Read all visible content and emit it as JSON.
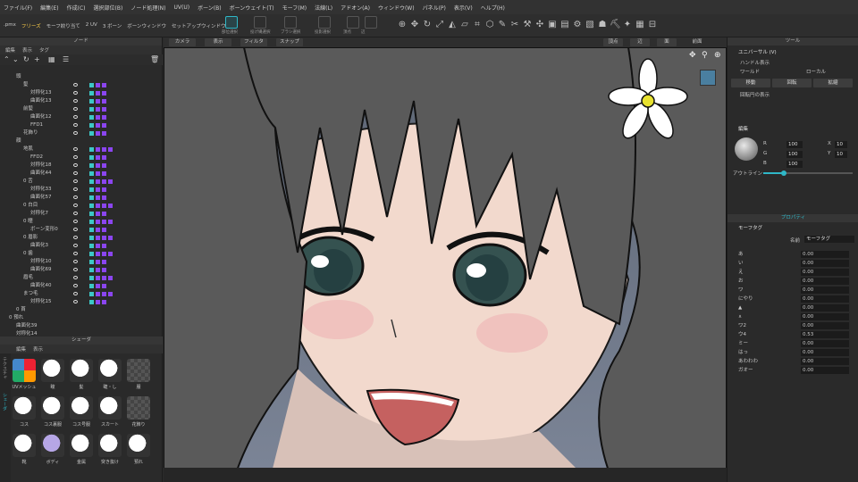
{
  "menu": [
    "ファイル(F)",
    "編集(E)",
    "作成(C)",
    "選択部位(B)",
    "ノード処理(N)",
    "UV(U)",
    "ボーン(B)",
    "ボーンウェイト(T)",
    "モーフ(M)",
    "法線(L)",
    "アドオン(A)",
    "ウィンドウ(W)",
    "パネル(P)",
    "表示(V)",
    "ヘルプ(H)"
  ],
  "toolbar": {
    "left_items": [
      ".pmx",
      "フリーズ",
      "モーフ絞り当て",
      "2 UV",
      "3 ボーン",
      "ボーンウィンドウ",
      "セットアップウィンドウ"
    ],
    "tools": [
      "部位選択",
      "投げ縄選択",
      "ブラシ選択",
      "投影選択",
      "頂点",
      "辺"
    ]
  },
  "left_panel": {
    "title": "ノード",
    "menu": [
      "編集",
      "表示",
      "タグ"
    ],
    "tree": [
      {
        "label": "頭",
        "indent": 1,
        "colors": []
      },
      {
        "label": "髪",
        "indent": 2,
        "colors": [
          "#3cc7c7",
          "#8b45f0",
          "#8b45f0"
        ]
      },
      {
        "label": "対称化13",
        "indent": 3,
        "colors": [
          "#3cc7c7",
          "#8b45f0",
          "#8b45f0"
        ]
      },
      {
        "label": "曲面化13",
        "indent": 3,
        "colors": [
          "#3cc7c7",
          "#8b45f0",
          "#8b45f0"
        ]
      },
      {
        "label": "前髪",
        "indent": 2,
        "colors": [
          "#3cc7c7",
          "#8b45f0",
          "#8b45f0"
        ]
      },
      {
        "label": "曲面化12",
        "indent": 3,
        "colors": [
          "#3cc7c7",
          "#8b45f0",
          "#8b45f0"
        ]
      },
      {
        "label": "FFD1",
        "indent": 3,
        "colors": [
          "#3cc7c7",
          "#8b45f0",
          "#8b45f0"
        ]
      },
      {
        "label": "花飾り",
        "indent": 2,
        "colors": [
          "#3cc7c7",
          "#8b45f0",
          "#8b45f0"
        ]
      },
      {
        "label": "顔",
        "indent": 1,
        "colors": []
      },
      {
        "label": "地肌",
        "indent": 2,
        "colors": [
          "#3cc7c7",
          "#8b45f0",
          "#8b45f0",
          "#8b45f0"
        ]
      },
      {
        "label": "FFD2",
        "indent": 3,
        "colors": [
          "#3cc7c7",
          "#8b45f0",
          "#8b45f0"
        ]
      },
      {
        "label": "対称化18",
        "indent": 3,
        "colors": [
          "#3cc7c7",
          "#8b45f0",
          "#8b45f0"
        ]
      },
      {
        "label": "曲面化44",
        "indent": 3,
        "colors": [
          "#3cc7c7",
          "#8b45f0",
          "#8b45f0"
        ]
      },
      {
        "label": "0 舌",
        "indent": 2,
        "colors": [
          "#3cc7c7",
          "#8b45f0",
          "#8b45f0",
          "#8b45f0"
        ]
      },
      {
        "label": "対称化33",
        "indent": 3,
        "colors": [
          "#3cc7c7",
          "#8b45f0",
          "#8b45f0"
        ]
      },
      {
        "label": "曲面化57",
        "indent": 3,
        "colors": [
          "#3cc7c7",
          "#8b45f0",
          "#8b45f0"
        ]
      },
      {
        "label": "0 白目",
        "indent": 2,
        "colors": [
          "#3cc7c7",
          "#8b45f0",
          "#8b45f0",
          "#8b45f0"
        ]
      },
      {
        "label": "対称化7",
        "indent": 3,
        "colors": [
          "#3cc7c7",
          "#8b45f0",
          "#8b45f0"
        ]
      },
      {
        "label": "0 瞳",
        "indent": 2,
        "colors": [
          "#3cc7c7",
          "#8b45f0",
          "#8b45f0",
          "#8b45f0"
        ]
      },
      {
        "label": "ボーン変形0",
        "indent": 3,
        "colors": [
          "#3cc7c7",
          "#8b45f0",
          "#8b45f0"
        ]
      },
      {
        "label": "0 眉影",
        "indent": 2,
        "colors": [
          "#3cc7c7",
          "#8b45f0",
          "#8b45f0",
          "#8b45f0"
        ]
      },
      {
        "label": "曲面化3",
        "indent": 3,
        "colors": [
          "#3cc7c7",
          "#8b45f0",
          "#8b45f0"
        ]
      },
      {
        "label": "0 歯",
        "indent": 2,
        "colors": [
          "#3cc7c7",
          "#8b45f0",
          "#8b45f0",
          "#8b45f0"
        ]
      },
      {
        "label": "対称化10",
        "indent": 3,
        "colors": [
          "#3cc7c7",
          "#8b45f0",
          "#8b45f0"
        ]
      },
      {
        "label": "曲面化69",
        "indent": 3,
        "colors": [
          "#3cc7c7",
          "#8b45f0",
          "#8b45f0"
        ]
      },
      {
        "label": "眉毛",
        "indent": 2,
        "colors": [
          "#3cc7c7",
          "#8b45f0",
          "#8b45f0",
          "#8b45f0"
        ]
      },
      {
        "label": "曲面化40",
        "indent": 3,
        "colors": [
          "#3cc7c7",
          "#8b45f0",
          "#8b45f0"
        ]
      },
      {
        "label": "まつ毛",
        "indent": 2,
        "colors": [
          "#3cc7c7",
          "#8b45f0",
          "#8b45f0",
          "#8b45f0"
        ]
      },
      {
        "label": "対称化15",
        "indent": 3,
        "colors": [
          "#3cc7c7",
          "#8b45f0",
          "#8b45f0"
        ]
      },
      {
        "label": "0 首",
        "indent": 1,
        "colors": []
      },
      {
        "label": "0 預れ",
        "indent": 0,
        "colors": []
      },
      {
        "label": "曲面化39",
        "indent": 1,
        "colors": []
      },
      {
        "label": "対称化14",
        "indent": 1,
        "colors": []
      }
    ],
    "shader_title": "シェーダ",
    "shader_menu": [
      "編集",
      "表示"
    ],
    "shaders": [
      {
        "label": "UVメッシュ",
        "type": "uv"
      },
      {
        "label": "瞳",
        "type": "white"
      },
      {
        "label": "髪",
        "type": "white"
      },
      {
        "label": "睫・し",
        "type": "white"
      },
      {
        "label": "服",
        "type": "check"
      },
      {
        "label": "コス",
        "type": "white"
      },
      {
        "label": "コス裏服",
        "type": "white"
      },
      {
        "label": "コス号服",
        "type": "white"
      },
      {
        "label": "スカート",
        "type": "white"
      },
      {
        "label": "花飾り",
        "type": "check"
      },
      {
        "label": "靴",
        "type": "white"
      },
      {
        "label": "ボディ",
        "type": "purple"
      },
      {
        "label": "金属",
        "type": "white"
      },
      {
        "label": "突き抜け",
        "type": "white"
      },
      {
        "label": "預れ",
        "type": "white"
      }
    ],
    "shader_side": [
      "テクスチャ",
      "シェーダ"
    ]
  },
  "viewport": {
    "header": [
      "カメラ",
      "表示",
      "フィルタ",
      "スナップ"
    ],
    "modes": [
      "頂点",
      "辺",
      "面"
    ],
    "front": "前面"
  },
  "right_panel": {
    "title": "ツール",
    "universal": "ユニバーサル (V)",
    "handle_show": "ハンドル表示",
    "world": "ワールド",
    "local": "ローカル",
    "move": "移動",
    "rotate": "回転",
    "scale": "拡縮",
    "pivot_show": "回転円の表示",
    "edit_title": "編集",
    "rgb": {
      "R": "100",
      "G": "100",
      "B": "100"
    },
    "xy": {
      "X": "10",
      "Y": "10"
    },
    "outline": "アウトライン",
    "properties_title": "プロパティ",
    "morph_tag": "モーフタグ",
    "name_label": "名前",
    "name_value": "モーフタグ",
    "morphs": [
      {
        "name": "あ",
        "value": "0.00"
      },
      {
        "name": "い",
        "value": "0.00"
      },
      {
        "name": "え",
        "value": "0.00"
      },
      {
        "name": "お",
        "value": "0.00"
      },
      {
        "name": "ワ",
        "value": "0.00"
      },
      {
        "name": "にやり",
        "value": "0.00"
      },
      {
        "name": "▲",
        "value": "0.00"
      },
      {
        "name": "∧",
        "value": "0.00"
      },
      {
        "name": "ワ2",
        "value": "0.00"
      },
      {
        "name": "ウ4",
        "value": "0.53"
      },
      {
        "name": "ミー",
        "value": "0.00"
      },
      {
        "name": "はっ",
        "value": "0.00"
      },
      {
        "name": "あわわわ",
        "value": "0.00"
      },
      {
        "name": "ガオー",
        "value": "0.00"
      }
    ]
  }
}
